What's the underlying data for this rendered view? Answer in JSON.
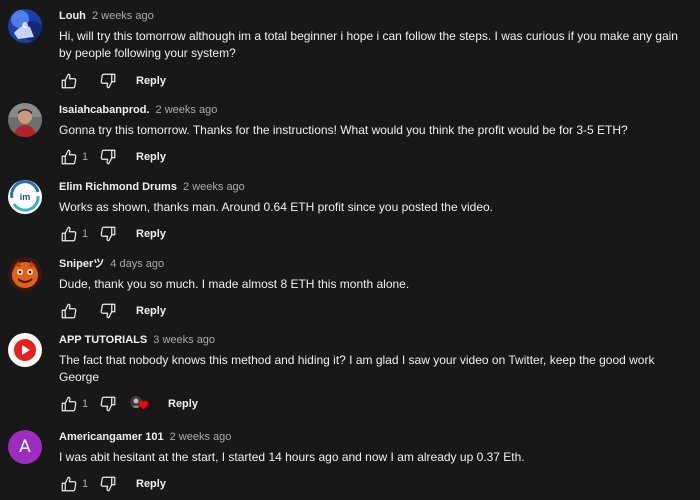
{
  "comments": [
    {
      "author": "Louh",
      "time": "2 weeks ago",
      "text": "Hi, will try this tomorrow although im a total beginner i hope i can follow the steps. I was curious if you make any gain by people following your system?",
      "likes": "",
      "reply_label": "Reply",
      "avatar": "blue-photo-avatar"
    },
    {
      "author": "Isaiahcabanprod.",
      "time": "2 weeks ago",
      "text": "Gonna try this tomorrow. Thanks for the instructions! What would you think the profit would be for 3-5 ETH?",
      "likes": "1",
      "reply_label": "Reply",
      "avatar": "person-photo-avatar"
    },
    {
      "author": "Elim Richmond Drums",
      "time": "2 weeks ago",
      "text": "Works as shown, thanks man. Around 0.64 ETH profit since you posted the video.",
      "likes": "1",
      "reply_label": "Reply",
      "avatar": "elim-logo-avatar"
    },
    {
      "author": "Sniperツ",
      "time": "4 days ago",
      "text": "Dude, thank you so much. I made almost 8 ETH this month alone.",
      "likes": "",
      "reply_label": "Reply",
      "avatar": "orange-character-avatar"
    },
    {
      "author": "APP TUTORIALS",
      "time": "3 weeks ago",
      "text": "The fact that nobody knows this method and hiding it? I am glad I saw your video on Twitter, keep the good work George",
      "likes": "1",
      "reply_label": "Reply",
      "avatar": "red-play-logo-avatar",
      "creator_heart": true
    },
    {
      "author": "Americangamer 101",
      "time": "2 weeks ago",
      "text": "I was abit hesitant at the start, I started 14 hours ago and now I am already up 0.37 Eth.",
      "likes": "1",
      "reply_label": "Reply",
      "avatar": "letter-avatar",
      "avatar_letter": "A"
    }
  ],
  "colors": {
    "background": "#181818",
    "text": "#f1f1f1",
    "secondary_text": "#aaaaaa",
    "heart": "#ff0000",
    "letter_avatar": "#9c2dbf"
  }
}
